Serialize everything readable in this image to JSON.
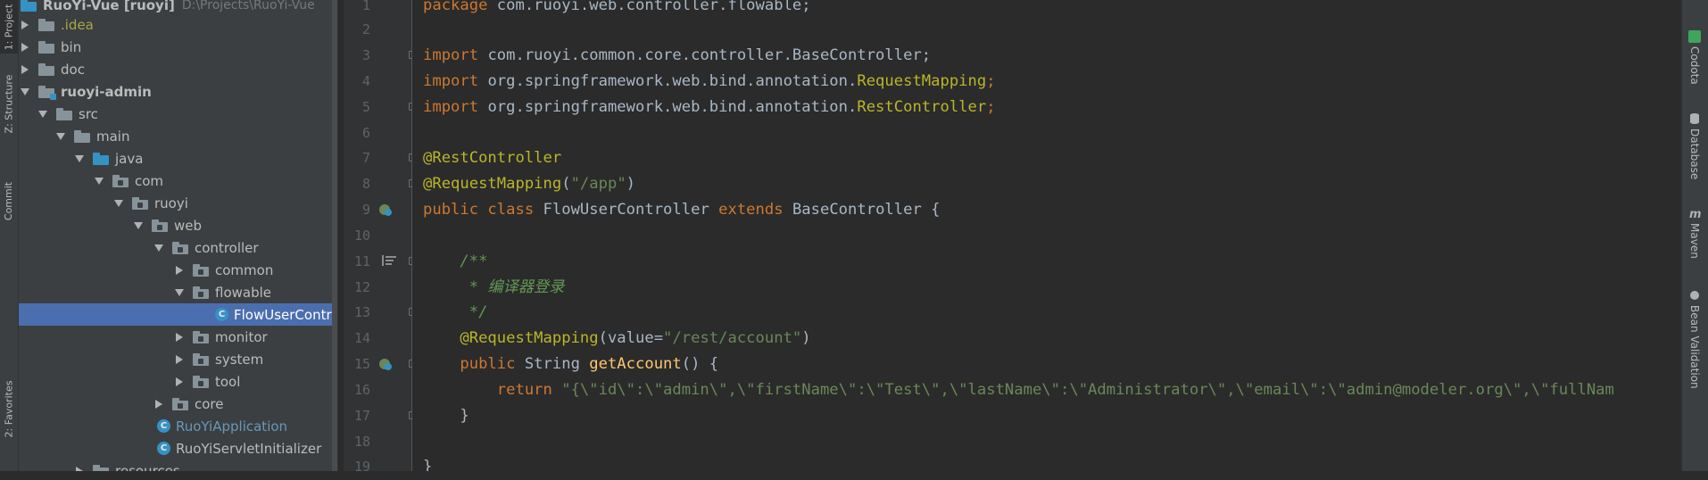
{
  "left_strip": {
    "project_tab": "1: Project",
    "structure_tab": "Z: Structure",
    "commit_tab": "Commit",
    "favorites_tab": "2: Favorites"
  },
  "tree": {
    "root_name": "RuoYi-Vue [ruoyi]",
    "root_path": "D:\\Projects\\RuoYi-Vue",
    "items": [
      {
        "label": ".idea"
      },
      {
        "label": "bin"
      },
      {
        "label": "doc"
      },
      {
        "label": "ruoyi-admin"
      },
      {
        "label": "src"
      },
      {
        "label": "main"
      },
      {
        "label": "java"
      },
      {
        "label": "com"
      },
      {
        "label": "ruoyi"
      },
      {
        "label": "web"
      },
      {
        "label": "controller"
      },
      {
        "label": "common"
      },
      {
        "label": "flowable"
      },
      {
        "label": "FlowUserController"
      },
      {
        "label": "monitor"
      },
      {
        "label": "system"
      },
      {
        "label": "tool"
      },
      {
        "label": "core"
      },
      {
        "label": "RuoYiApplication"
      },
      {
        "label": "RuoYiServletInitializer"
      },
      {
        "label": "resources"
      }
    ]
  },
  "editor": {
    "line_numbers": [
      "1",
      "2",
      "3",
      "4",
      "5",
      "6",
      "7",
      "8",
      "9",
      "10",
      "11",
      "12",
      "13",
      "14",
      "15",
      "16",
      "17",
      "18",
      "19"
    ],
    "code": {
      "l1_kw": "package",
      "l1_rest": " com.ruoyi.web.controller.flowable;",
      "l3_kw": "import",
      "l3_rest": " com.ruoyi.common.core.controller.BaseController;",
      "l4_kw": "import",
      "l4_pkg": " org.springframework.web.bind.annotation.",
      "l4_cls": "RequestMapping",
      "l4_semi": ";",
      "l5_kw": "import",
      "l5_pkg": " org.springframework.web.bind.annotation.",
      "l5_cls": "RestController",
      "l5_semi": ";",
      "l7_ann": "@RestController",
      "l8_ann": "@RequestMapping",
      "l8_open": "(",
      "l8_str": "\"/app\"",
      "l8_close": ")",
      "l9_kw1": "public class ",
      "l9_name": "FlowUserController ",
      "l9_kw2": "extends ",
      "l9_rest": "BaseController {",
      "l11_doc": "    /**",
      "l12_doc": "     * 编译器登录",
      "l13_doc": "     */",
      "l14_ann": "    @RequestMapping",
      "l14_open": "(value=",
      "l14_str": "\"/rest/account\"",
      "l14_close": ")",
      "l15_kw": "    public ",
      "l15_type": "String ",
      "l15_fn": "getAccount",
      "l15_rest": "() {",
      "l16_kw": "        return ",
      "l16_str": "\"{\\\"id\\\":\\\"admin\\\",\\\"firstName\\\":\\\"Test\\\",\\\"lastName\\\":\\\"Administrator\\\",\\\"email\\\":\\\"admin@modeler.org\\\",\\\"fullNam",
      "l17": "    }",
      "l19": "}"
    }
  },
  "right_strip": {
    "codota_tab": "Codota",
    "database_tab": "Database",
    "maven_tab": "Maven",
    "bean_tab": "Bean Validation"
  },
  "colors": {
    "editor_bg": "#2b2b2b",
    "panel_bg": "#3c3f41",
    "selection": "#4b6eaf",
    "keyword": "#cc7832",
    "annotation": "#bbb529",
    "string": "#6a8759"
  }
}
